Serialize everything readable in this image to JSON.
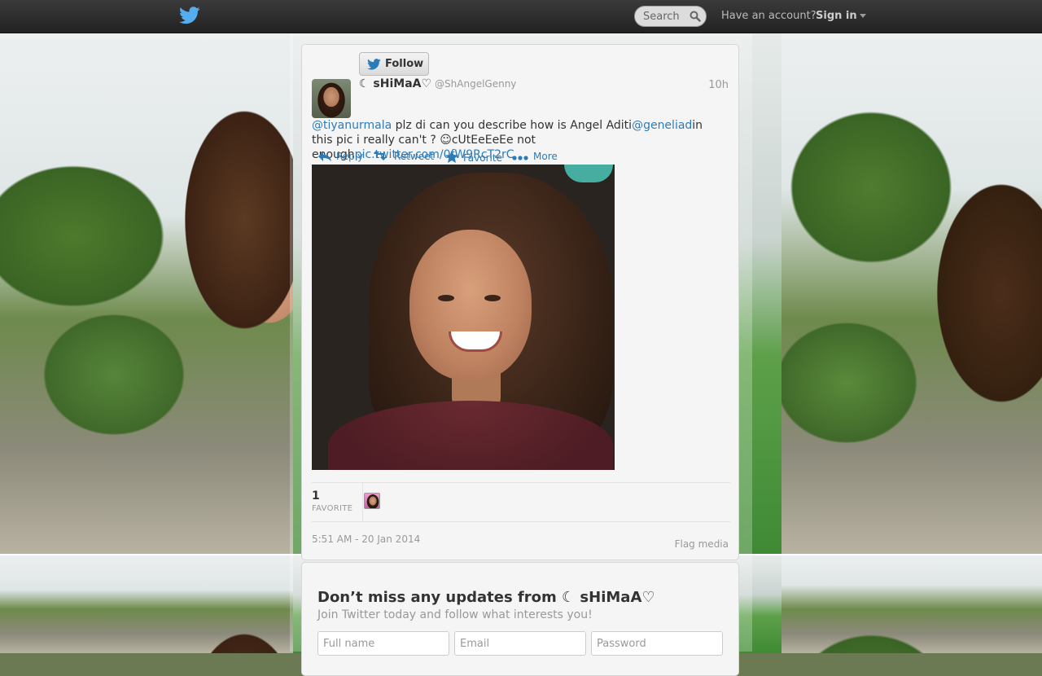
{
  "topbar": {
    "search_placeholder": "Search",
    "have_account": "Have an account?",
    "sign_in": "Sign in"
  },
  "tweet": {
    "follow_label": "Follow",
    "fullname": "☾ sHiMaA♡",
    "handle": "@ShAngelGenny",
    "time": "10h",
    "mention1": "@tiyanurmala",
    "text_part1": " plz di can you describe how is Angel Aditi",
    "mention2": "@geneliad",
    "text_part2": "in this pic i really can't ? ☺cUtEeEeEe not enough",
    "pic_link": "pic.twitter.com/0fW9RcT2rC",
    "actions": {
      "reply": "Reply",
      "retweet": "Retweet",
      "favorite": "Favorite",
      "more": "More"
    },
    "favorites_count": "1",
    "favorites_label": "FAVORITE",
    "timestamp": "5:51 AM - 20 Jan 2014",
    "flag_media": "Flag media"
  },
  "signup": {
    "heading": "Don’t miss any updates from ☾ sHiMaA♡",
    "subheading": "Join Twitter today and follow what interests you!",
    "fullname_placeholder": "Full name",
    "email_placeholder": "Email",
    "password_placeholder": "Password"
  },
  "colors": {
    "link": "#2b7bb9",
    "topbar": "#2a2a2a",
    "muted": "#999999"
  }
}
